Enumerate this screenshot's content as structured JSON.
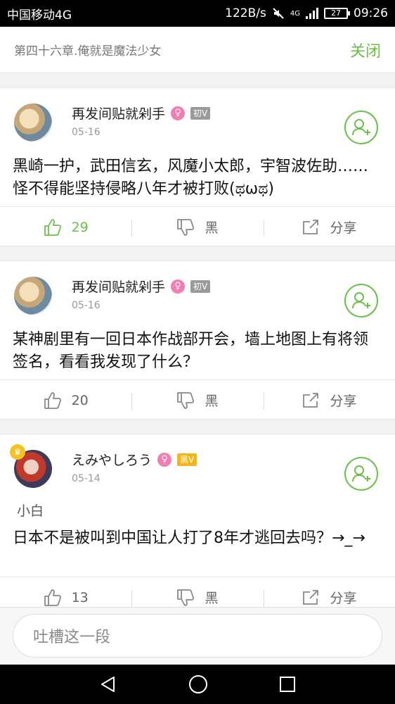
{
  "status_bar": {
    "carrier": "中国移动4G",
    "speed": "122B/s",
    "network": "4G",
    "battery": "27",
    "time": "09:26"
  },
  "header": {
    "chapter_title": "第四十六章.俺就是魔法少女",
    "close_label": "关闭"
  },
  "comments": [
    {
      "username": "再发间贴就剁手",
      "gender_icon": "female-icon",
      "level": "初V",
      "date": "05-16",
      "text": "黑崎一护，武田信玄，风魔小太郎，宇智波佐助……怪不得能坚持侵略八年才被打败(ಥωಥ)",
      "like_count": "29",
      "dislike_label": "黑",
      "share_label": "分享",
      "liked": true
    },
    {
      "username": "再发间贴就剁手",
      "gender_icon": "female-icon",
      "level": "初V",
      "date": "05-16",
      "text": "某神剧里有一回日本作战部开会，墙上地图上有将领签名，看看我发现了什么？",
      "like_count": "20",
      "dislike_label": "黑",
      "share_label": "分享",
      "liked": false
    },
    {
      "username": "えみやしろう",
      "gender_icon": "female-icon",
      "level": "黑V",
      "date": "05-14",
      "quote": "小白",
      "text": "日本不是被叫到中国让人打了8年才逃回去吗？→_→",
      "like_count": "13",
      "dislike_label": "黑",
      "share_label": "分享",
      "liked": false
    }
  ],
  "comment_input": {
    "placeholder": "吐槽这一段"
  },
  "colors": {
    "accent": "#6cbf4b",
    "female": "#f27db0",
    "level_gray": "#9a9a9a",
    "level_gold": "#f2b51a"
  }
}
